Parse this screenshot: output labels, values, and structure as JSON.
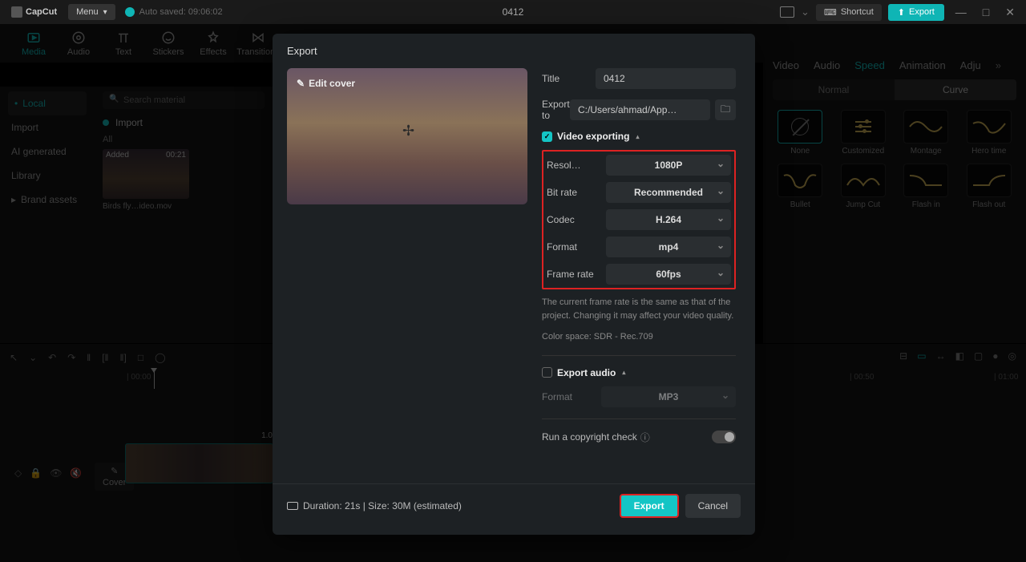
{
  "app": {
    "name": "CapCut",
    "menu": "Menu",
    "autosave": "Auto saved: 09:06:02",
    "projectTitle": "0412",
    "shortcut": "Shortcut",
    "exportTop": "Export"
  },
  "tooltabs": [
    {
      "label": "Media",
      "active": true
    },
    {
      "label": "Audio"
    },
    {
      "label": "Text"
    },
    {
      "label": "Stickers"
    },
    {
      "label": "Effects"
    },
    {
      "label": "Transitions"
    }
  ],
  "leftNav": {
    "local": "Local",
    "import": "Import",
    "ai": "AI generated",
    "library": "Library",
    "brand": "Brand assets"
  },
  "media": {
    "searchPlaceholder": "Search material",
    "importLabel": "Import",
    "allLabel": "All",
    "thumb": {
      "badge": "Added",
      "duration": "00:21",
      "name": "Birds fly…ideo.mov"
    }
  },
  "rightPanel": {
    "tabs": [
      "Video",
      "Audio",
      "Speed",
      "Animation",
      "Adju"
    ],
    "activeTab": "Speed",
    "seg": {
      "normal": "Normal",
      "curve": "Curve"
    },
    "presets": [
      {
        "label": "None",
        "kind": "none"
      },
      {
        "label": "Customized",
        "kind": "sliders"
      },
      {
        "label": "Montage",
        "kind": "wave"
      },
      {
        "label": "Hero time",
        "kind": "wave"
      },
      {
        "label": "Bullet",
        "kind": "wave"
      },
      {
        "label": "Jump Cut",
        "kind": "wave"
      },
      {
        "label": "Flash in",
        "kind": "wave"
      },
      {
        "label": "Flash out",
        "kind": "wave"
      }
    ]
  },
  "timeline": {
    "ticks": [
      "| 00:00",
      "| 00:50",
      "| 01:00"
    ],
    "cover": "Cover",
    "clipNum": "1.0"
  },
  "modal": {
    "title": "Export",
    "editCover": "Edit cover",
    "titleLabel": "Title",
    "titleValue": "0412",
    "exportToLabel": "Export to",
    "exportToValue": "C:/Users/ahmad/App…",
    "videoExporting": "Video exporting",
    "options": [
      {
        "label": "Resol…",
        "value": "1080P"
      },
      {
        "label": "Bit rate",
        "value": "Recommended"
      },
      {
        "label": "Codec",
        "value": "H.264"
      },
      {
        "label": "Format",
        "value": "mp4"
      },
      {
        "label": "Frame rate",
        "value": "60fps"
      }
    ],
    "hint": "The current frame rate is the same as that of the project. Changing it may affect your video quality.",
    "colorspace": "Color space: SDR - Rec.709",
    "exportAudio": "Export audio",
    "audioFormatLabel": "Format",
    "audioFormatValue": "MP3",
    "copyright": "Run a copyright check",
    "duration": "Duration: 21s | Size: 30M (estimated)",
    "exportBtn": "Export",
    "cancelBtn": "Cancel"
  }
}
